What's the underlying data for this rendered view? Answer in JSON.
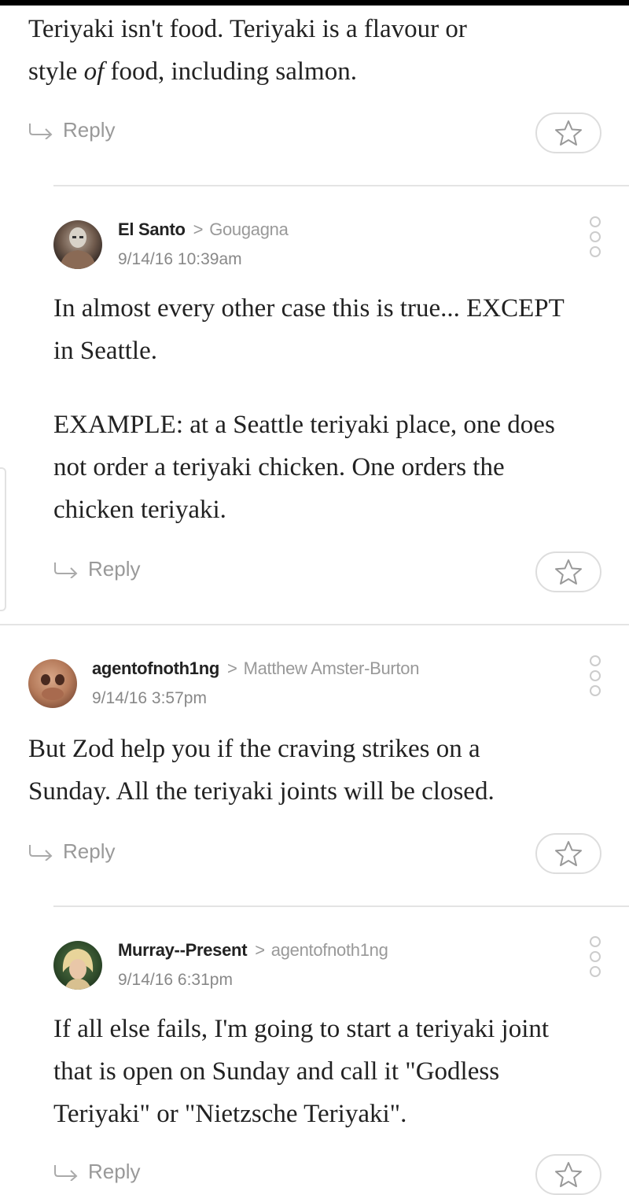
{
  "comments": [
    {
      "body": [
        "Teriyaki isn't food. Teriyaki is a flavour or",
        "style ",
        "of",
        " food, including salmon."
      ],
      "reply_label": "Reply"
    },
    {
      "author": "El Santo",
      "reply_to": "Gougagna",
      "timestamp": "9/14/16 10:39am",
      "body_p1": [
        "In almost every other case this is true... EXCEPT",
        "in Seattle."
      ],
      "body_p2": [
        "EXAMPLE: at a Seattle teriyaki place, one does",
        "not order a teriyaki chicken. One orders the",
        "chicken teriyaki."
      ],
      "reply_label": "Reply"
    },
    {
      "author": "agentofnoth1ng",
      "reply_to": "Matthew Amster-Burton",
      "timestamp": "9/14/16 3:57pm",
      "body": [
        "But Zod help you if the craving strikes on a",
        "Sunday. All the teriyaki joints will be closed."
      ],
      "reply_label": "Reply"
    },
    {
      "author": "Murray--Present",
      "reply_to": "agentofnoth1ng",
      "timestamp": "9/14/16 6:31pm",
      "body": [
        "If all else fails, I'm going to start a teriyaki joint",
        "that is open on Sunday and call it \"Godless",
        "Teriyaki\" or \"Nietzsche Teriyaki\"."
      ],
      "reply_label": "Reply"
    }
  ],
  "icons": {
    "reply": "reply-arrow-icon",
    "star": "star-outline-icon",
    "more": "more-vertical-dots-icon"
  },
  "colors": {
    "text": "#222222",
    "muted": "#999999",
    "divider": "#e4e4e4"
  }
}
